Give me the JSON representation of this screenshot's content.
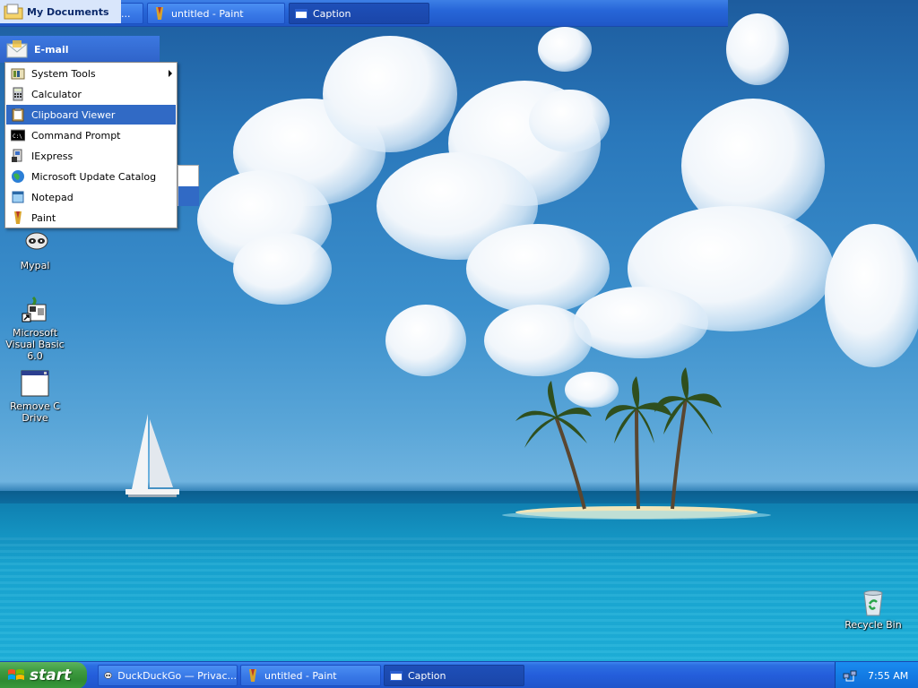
{
  "top_bar": {
    "my_documents": "My Documents",
    "tasks": [
      {
        "label": "...",
        "icon": "browser-icon"
      },
      {
        "label": "untitled - Paint",
        "icon": "paint-icon"
      },
      {
        "label": "Caption",
        "icon": "window-icon",
        "active": true
      }
    ]
  },
  "start_menu": {
    "email_label": "E-mail",
    "submenu": [
      {
        "label": "System Tools",
        "icon": "system-tools-icon",
        "has_arrow": true
      },
      {
        "label": "Calculator",
        "icon": "calculator-icon"
      },
      {
        "label": "Clipboard Viewer",
        "icon": "clipboard-icon",
        "highlighted": true
      },
      {
        "label": "Command Prompt",
        "icon": "command-prompt-icon"
      },
      {
        "label": "IExpress",
        "icon": "iexpress-icon"
      },
      {
        "label": "Microsoft Update Catalog",
        "icon": "globe-icon"
      },
      {
        "label": "Notepad",
        "icon": "notepad-icon"
      },
      {
        "label": "Paint",
        "icon": "paint-icon"
      }
    ]
  },
  "desktop_icons": [
    {
      "label": "Mypal",
      "icon": "mypal-raccoon-icon"
    },
    {
      "label": "Microsoft Visual Basic 6.0",
      "icon": "visual-basic-icon"
    },
    {
      "label": "Remove C Drive",
      "icon": "window-icon"
    },
    {
      "label": "Recycle Bin",
      "icon": "recycle-bin-icon"
    }
  ],
  "taskbar": {
    "start_label": "start",
    "tasks": [
      {
        "label": "DuckDuckGo — Privac...",
        "icon": "browser-icon"
      },
      {
        "label": "untitled - Paint",
        "icon": "paint-icon"
      },
      {
        "label": "Caption",
        "icon": "window-icon",
        "active": true
      }
    ],
    "clock": "7:55 AM"
  },
  "colors": {
    "taskbar_blue": "#245edb",
    "start_green": "#3e9a40",
    "menu_highlight": "#316ac5"
  }
}
